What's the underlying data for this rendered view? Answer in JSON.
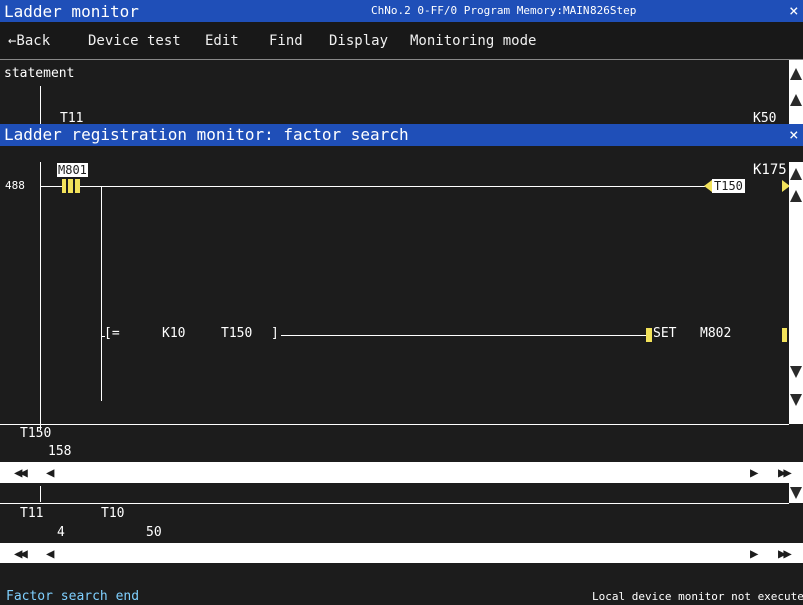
{
  "title": {
    "app": "Ladder monitor",
    "channel": "ChNo.2 0-FF/0 Program Memory:MAIN",
    "steps": "826Step",
    "close": "×"
  },
  "menu": {
    "items": [
      "←Back",
      "Device test",
      "Edit",
      "Find",
      "Display",
      "Monitoring mode"
    ]
  },
  "upper": {
    "statement": "statement",
    "left_device": "T11",
    "right_device": "K50"
  },
  "dialog": {
    "title": "Ladder registration monitor: factor search",
    "close": "×",
    "step_no": "488",
    "contact": "M801",
    "coil_limit": "K175",
    "coil": "T150",
    "compare_open": "[=",
    "compare_arg1": "K10",
    "compare_arg2": "T150",
    "compare_close": "]",
    "set_label": "SET",
    "set_device": "M802"
  },
  "watch1": {
    "device": "T150",
    "value": "158"
  },
  "watch2": {
    "device1": "T11",
    "value1": "4",
    "device2": "T10",
    "value2": "50"
  },
  "nav": {
    "first": "◀◀",
    "prev": "◀",
    "next": "▶",
    "last": "▶▶"
  },
  "status": {
    "left": "Factor search end",
    "right": "Local device monitor not executed."
  },
  "colors": {
    "title_bg": "#1f4fb8",
    "status_text": "#7fd0ff",
    "highlight": "#f2e25a"
  }
}
